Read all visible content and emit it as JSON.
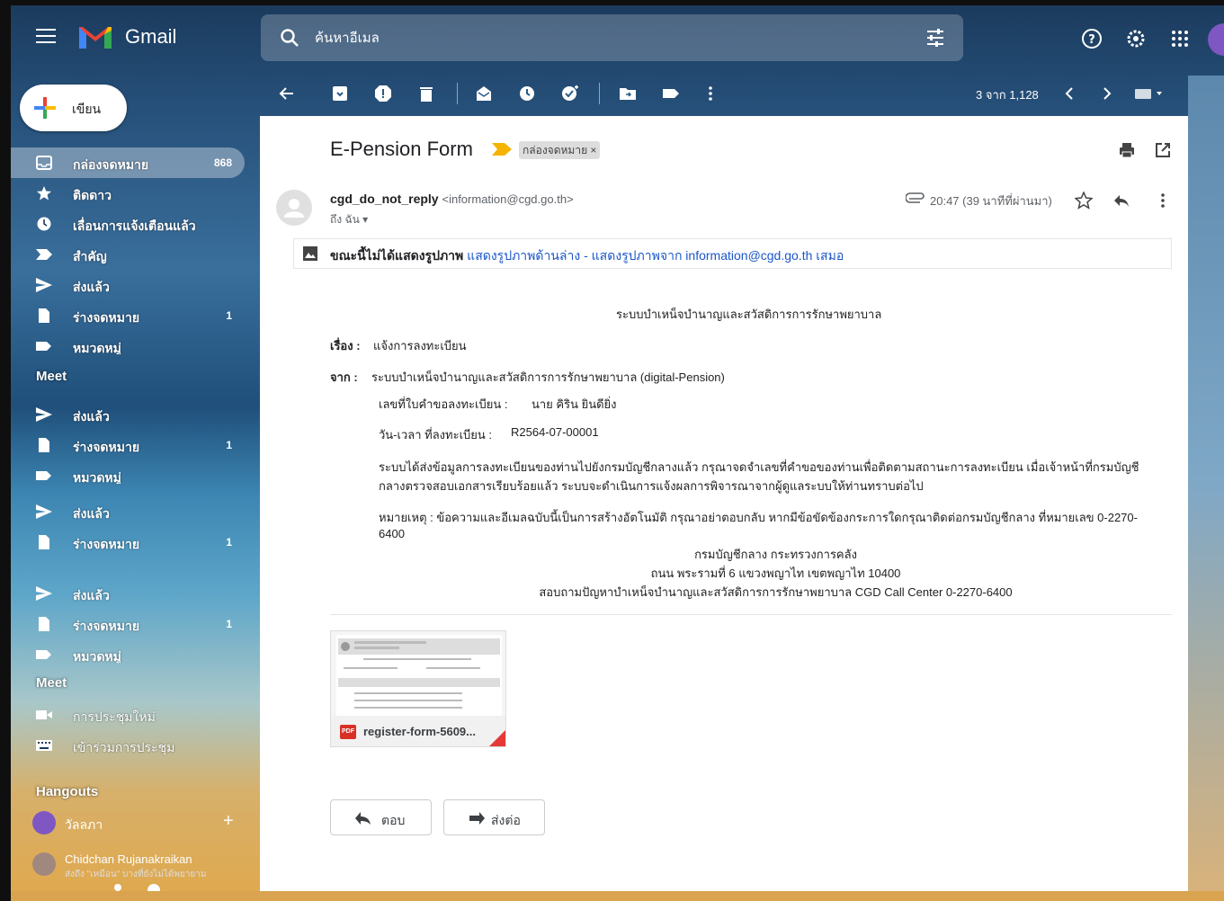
{
  "app": {
    "name": "Gmail"
  },
  "search": {
    "placeholder": "ค้นหาอีเมล"
  },
  "compose": {
    "label": "เขียน"
  },
  "sidebar": {
    "items": [
      {
        "label": "กล่องจดหมาย",
        "count": "868",
        "icon": "inbox-icon"
      },
      {
        "label": "ติดดาว",
        "count": "",
        "icon": "star-icon"
      },
      {
        "label": "เลื่อนการแจ้งเตือนแล้ว",
        "count": "",
        "icon": "clock-icon"
      },
      {
        "label": "สำคัญ",
        "count": "",
        "icon": "important-icon"
      },
      {
        "label": "ส่งแล้ว",
        "count": "",
        "icon": "send-icon"
      },
      {
        "label": "ร่างจดหมาย",
        "count": "1",
        "icon": "draft-icon"
      },
      {
        "label": "หมวดหมู่",
        "count": "",
        "icon": "label-icon"
      }
    ],
    "meet_title": "Meet",
    "repeat_items": [
      {
        "label": "ส่งแล้ว"
      },
      {
        "label": "ร่างจดหมาย",
        "count": "1"
      },
      {
        "label": "หมวดหมู่"
      },
      {
        "label": "ส่งแล้ว"
      },
      {
        "label": "ร่างจดหมาย",
        "count": "1"
      },
      {
        "label": "ส่งแล้ว"
      },
      {
        "label": "ร่างจดหมาย",
        "count": "1"
      },
      {
        "label": "หมวดหมู่"
      }
    ],
    "meet_title2": "Meet",
    "meet_items": [
      {
        "label": "การประชุมใหม่",
        "icon": "video-icon"
      },
      {
        "label": "เข้าร่วมการประชุม",
        "icon": "keyboard-icon"
      }
    ],
    "hangouts_title": "Hangouts",
    "hangouts_user": "วัลลภา",
    "hangouts_contact": "Chidchan Rujanakraikan",
    "hangouts_contact_preview": "ส่งถึง \"เหมือน\" บางที่ยังไม่ได้พยายาม"
  },
  "toolbar": {
    "pager": "3 จาก 1,128"
  },
  "message": {
    "subject": "E-Pension Form",
    "label_chip": "กล่องจดหมาย ×",
    "sender_name": "cgd_do_not_reply",
    "sender_email": "<information@cgd.go.th>",
    "to": "ถึง ฉัน ▾",
    "time": "20:47 (39 นาทีที่ผ่านมา)",
    "image_warning": "ขณะนี้ไม่ได้แสดงรูปภาพ",
    "show_images_below": "แสดงรูปภาพด้านล่าง",
    "show_images_always": "แสดงรูปภาพจาก information@cgd.go.th เสมอ",
    "heading": "ระบบบำเหน็จบำนาญและสวัสดิการการรักษาพยาบาล",
    "subject_label": "เรื่อง :",
    "subject_value": "แจ้งการลงทะเบียน",
    "from_label": "จาก :",
    "from_value": "ระบบบำเหน็จบำนาญและสวัสดิการการรักษาพยาบาล (digital-Pension)",
    "request_id_label": "เลขที่ใบคำขอลงทะเบียน :",
    "request_id_value": "นาย คิริน ยินดียิ่ง",
    "datetime_label": "วัน-เวลา ที่ลงทะเบียน :",
    "datetime_value": "R2564-07-00001",
    "para1_line1": "ระบบได้ส่งข้อมูลการลงทะเบียนของท่านไปยังกรมบัญชีกลางแล้ว กรุณาจดจำเลขที่คำขอของท่านเพื่อติดตามสถานะการลงทะเบียน เมื่อเจ้าหน้าที่กรมบัญชี",
    "para1_line2": "กลางตรวจสอบเอกสารเรียบร้อยแล้ว ระบบจะดำเนินการแจ้งผลการพิจารณาจากผู้ดูแลระบบให้ท่านทราบต่อไป",
    "note_line1": "หมายเหตุ : ข้อความและอีเมลฉบับนี้เป็นการสร้างอัตโนมัติ กรุณาอย่าตอบกลับ หากมีข้อขัดข้องกระการใดกรุณาติดต่อกรมบัญชีกลาง ที่หมายเลข 0-2270-",
    "note_line2": "6400",
    "footer1": "กรมบัญชีกลาง กระทรวงการคลัง",
    "footer2": "ถนน พระรามที่ 6 แขวงพญาไท เขตพญาไท 10400",
    "footer3": "สอบถามปัญหาบำเหน็จบำนาญและสวัสดิการการรักษาพยาบาล CGD Call Center 0-2270-6400",
    "attachment_name": "register-form-5609...",
    "attachment_type": "PDF",
    "reply_label": "ตอบ",
    "forward_label": "ส่งต่อ"
  },
  "colors": {
    "accent": "#1a73e8",
    "link": "#1a56c8",
    "importance": "#f4b400"
  }
}
